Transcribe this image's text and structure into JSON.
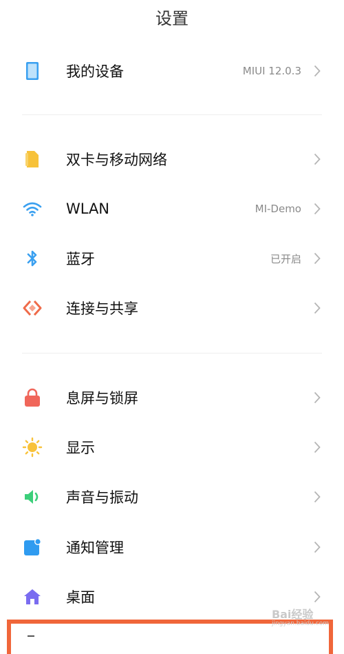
{
  "header": {
    "title": "设置"
  },
  "rows": [
    {
      "label": "我的设备",
      "value": "MIUI 12.0.3",
      "icon": "device-icon"
    },
    {
      "label": "双卡与移动网络",
      "value": "",
      "icon": "sim-card-icon"
    },
    {
      "label": "WLAN",
      "value": "MI-Demo",
      "icon": "wifi-icon"
    },
    {
      "label": "蓝牙",
      "value": "已开启",
      "icon": "bluetooth-icon"
    },
    {
      "label": "连接与共享",
      "value": "",
      "icon": "connection-share-icon"
    },
    {
      "label": "息屏与锁屏",
      "value": "",
      "icon": "lock-icon"
    },
    {
      "label": "显示",
      "value": "",
      "icon": "sun-icon"
    },
    {
      "label": "声音与振动",
      "value": "",
      "icon": "speaker-icon"
    },
    {
      "label": "通知管理",
      "value": "",
      "icon": "notification-icon"
    },
    {
      "label": "桌面",
      "value": "",
      "icon": "home-icon"
    }
  ],
  "watermark": {
    "text": "Bai经验",
    "sub": "jingyan.baidu.com"
  },
  "colors": {
    "accent_blue": "#3aa0f0",
    "sim_yellow": "#f7c23a",
    "connect_orange": "#ef6b4a",
    "lock_red": "#f0665a",
    "sun_yellow": "#f8c23a",
    "speaker_green": "#3ccf7a",
    "notify_blue": "#2f9bf0",
    "home_purple": "#7a6cf0",
    "highlight": "#f0663a"
  }
}
